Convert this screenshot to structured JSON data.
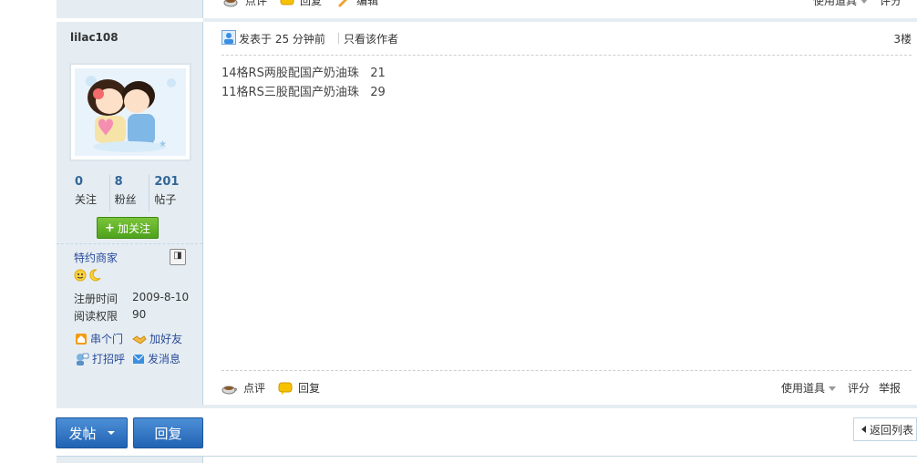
{
  "prev_post": {
    "comment_label": "点评",
    "reply_label": "回复",
    "edit_label": "编辑",
    "tools_label": "使用道具",
    "rate_label": "评分"
  },
  "author": {
    "username": "lilac108",
    "stats": [
      {
        "num": "0",
        "label": "关注"
      },
      {
        "num": "8",
        "label": "粉丝"
      },
      {
        "num": "201",
        "label": "帖子"
      }
    ],
    "follow_label": "加关注",
    "group": "特约商家",
    "info": [
      {
        "key": "注册时间",
        "value": "2009-8-10"
      },
      {
        "key": "阅读权限",
        "value": "90"
      }
    ],
    "links": {
      "visit": "串个门",
      "add_friend": "加好友",
      "greet": "打招呼",
      "message": "发消息"
    }
  },
  "post": {
    "posted_at": "发表于 25 分钟前",
    "only_author": "只看该作者",
    "floor": "3楼",
    "lines": [
      "14格RS两股配国产奶油珠   21",
      "11格RS三股配国产奶油珠   29"
    ],
    "footer": {
      "comment_label": "点评",
      "reply_label": "回复",
      "tools_label": "使用道具",
      "rate_label": "评分",
      "report_label": "举报"
    }
  },
  "bottom": {
    "new_post_label": "发帖",
    "reply_label": "回复",
    "back_label": "返回列表"
  },
  "colors": {
    "sidebar_bg": "#e5edf2",
    "link": "#2a4b9a",
    "stat_num": "#336699",
    "follow_green": "#5aae24",
    "button_blue": "#2d73c4"
  }
}
